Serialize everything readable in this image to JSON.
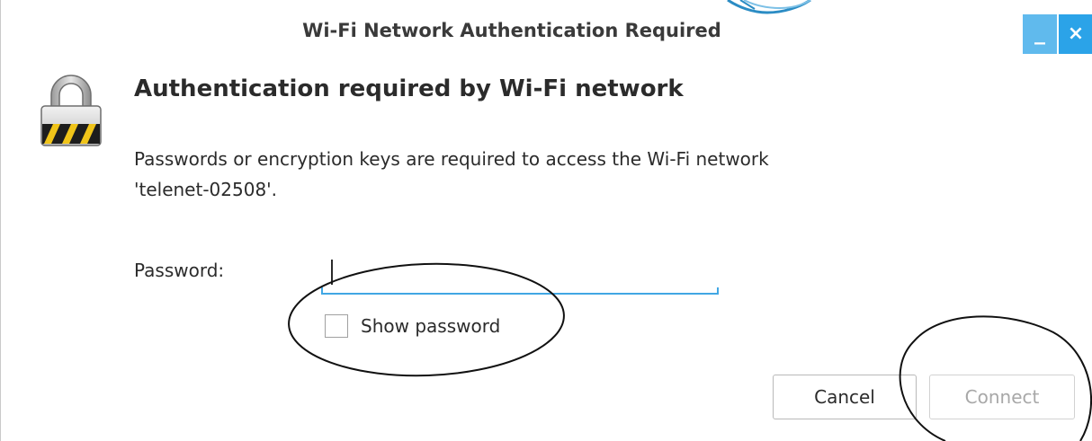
{
  "window": {
    "title": "Wi-Fi Network Authentication Required",
    "minimize_glyph": "_",
    "close_glyph": "×",
    "accent_color": "#2ba3e8"
  },
  "dialog": {
    "icon": "padlock-icon",
    "heading": "Authentication required by Wi-Fi network",
    "description_line1": "Passwords or encryption keys are required to access the Wi-Fi network",
    "description_line2": "'telenet-02508'.",
    "password_label": "Password:",
    "password_value": "",
    "show_password_label": "Show password",
    "show_password_checked": false
  },
  "buttons": {
    "cancel_label": "Cancel",
    "connect_label": "Connect",
    "connect_enabled": false
  }
}
